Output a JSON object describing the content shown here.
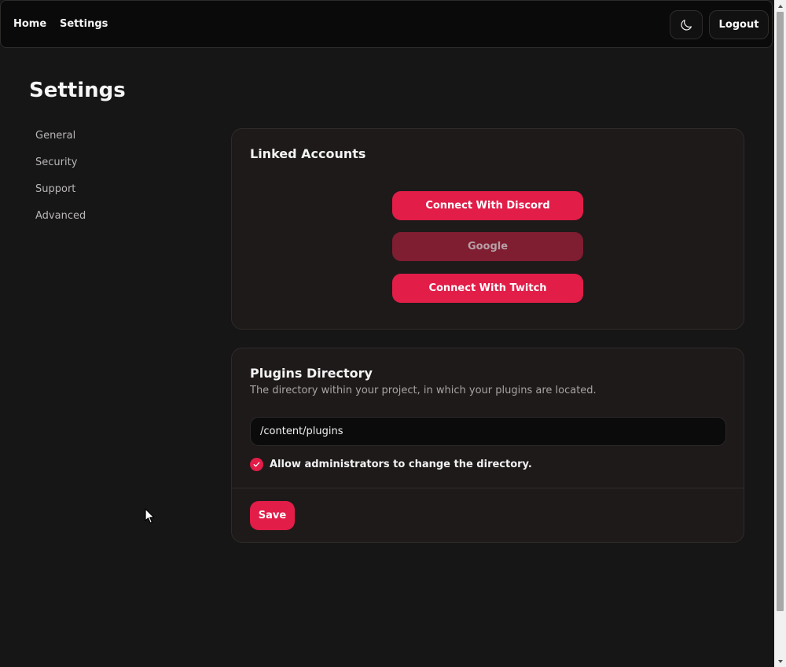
{
  "nav": {
    "home_label": "Home",
    "settings_label": "Settings",
    "theme_icon": "moon-icon",
    "logout_label": "Logout"
  },
  "page": {
    "title": "Settings"
  },
  "sidebar": {
    "items": [
      {
        "label": "General"
      },
      {
        "label": "Security"
      },
      {
        "label": "Support"
      },
      {
        "label": "Advanced"
      }
    ]
  },
  "linked_accounts": {
    "title": "Linked Accounts",
    "buttons": [
      {
        "label": "Connect With Discord",
        "enabled": true
      },
      {
        "label": "Google",
        "enabled": false
      },
      {
        "label": "Connect With Twitch",
        "enabled": true
      }
    ]
  },
  "plugins": {
    "title": "Plugins Directory",
    "description": "The directory within your project, in which your plugins are located.",
    "directory_value": "/content/plugins",
    "allow_admin_label": "Allow administrators to change the directory.",
    "allow_admin_checked": true,
    "save_label": "Save"
  },
  "colors": {
    "accent": "#e11d48",
    "accent_disabled": "#7f1d31",
    "background": "#171616",
    "card": "#1d1a19"
  }
}
